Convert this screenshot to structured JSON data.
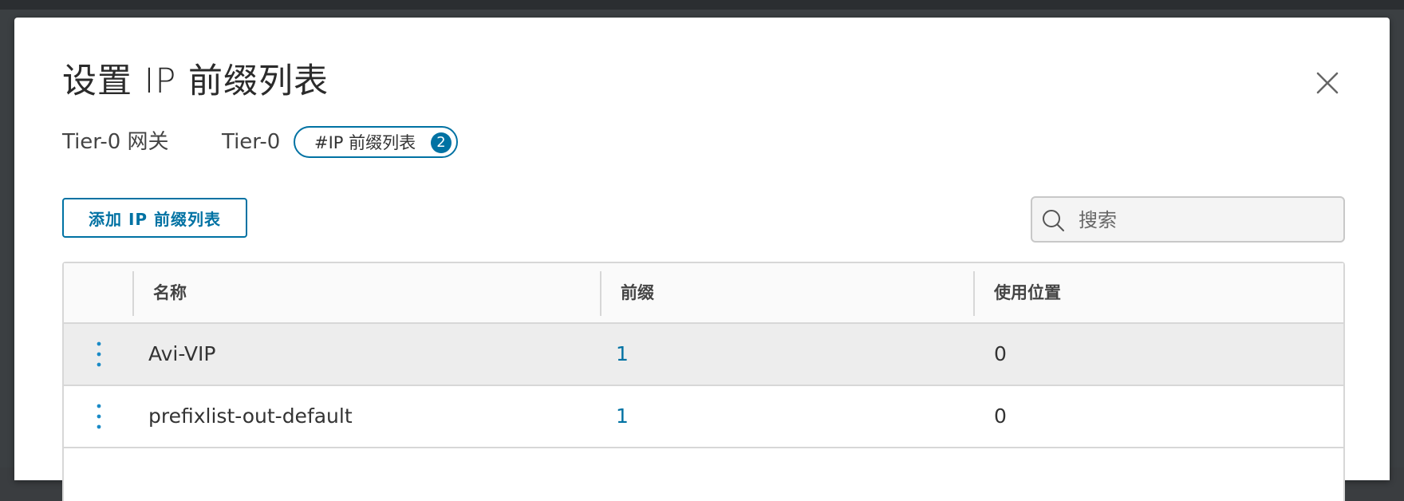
{
  "dialog": {
    "title": "设置 IP 前缀列表",
    "breadcrumb": {
      "gateway_label": "Tier-0 网关",
      "gateway_name": "Tier-0",
      "chip_label": "#IP 前缀列表",
      "chip_count": "2"
    },
    "add_button_label": "添加 IP 前缀列表",
    "search": {
      "placeholder": "搜索",
      "value": ""
    },
    "table": {
      "columns": [
        "名称",
        "前缀",
        "使用位置"
      ],
      "rows": [
        {
          "name": "Avi-VIP",
          "prefixes": "1",
          "used_in": "0",
          "selected": true
        },
        {
          "name": "prefixlist-out-default",
          "prefixes": "1",
          "used_in": "0",
          "selected": false
        }
      ]
    }
  },
  "colors": {
    "accent": "#0072a3",
    "row_selected": "#ededed",
    "border": "#d7d7d7"
  },
  "icons": {
    "close": "close-icon",
    "search": "search-icon",
    "row_menu": "vertical-ellipsis-icon"
  }
}
